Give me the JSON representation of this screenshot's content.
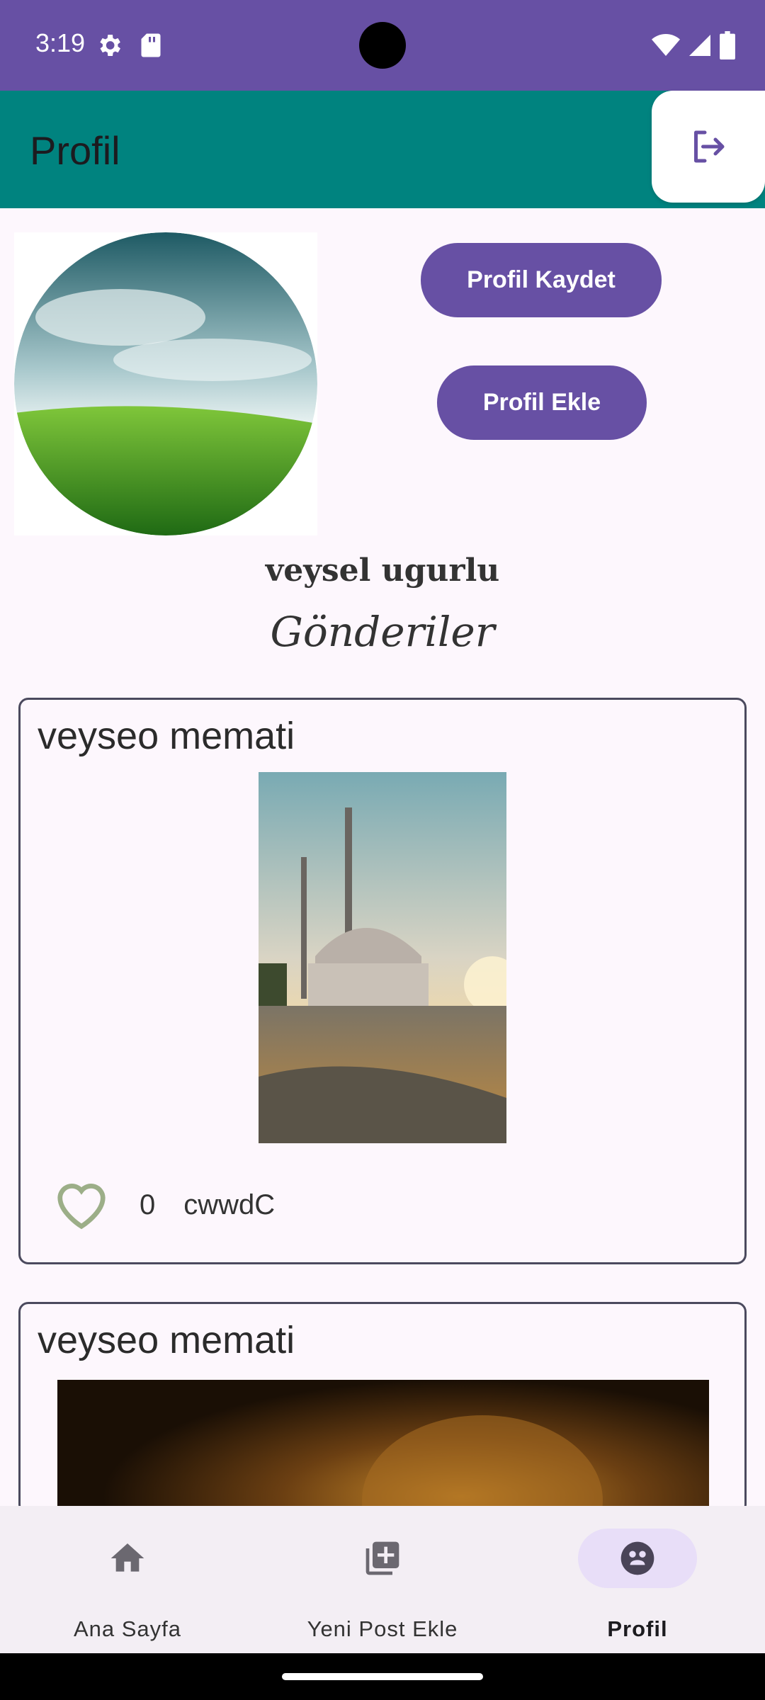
{
  "status_bar": {
    "time": "3:19",
    "icons": [
      "gear-icon",
      "sd-card-icon",
      "wifi-icon",
      "signal-icon",
      "battery-icon"
    ]
  },
  "app_bar": {
    "title": "Profil",
    "logout_icon": "logout-icon"
  },
  "profile": {
    "save_button": "Profil Kaydet",
    "add_button": "Profil Ekle",
    "username": "veysel ugurlu",
    "section_title": "Gönderiler"
  },
  "posts": [
    {
      "author": "veyseo memati",
      "likes": "0",
      "caption": "cwwdC"
    },
    {
      "author": "veyseo memati"
    }
  ],
  "bottom_nav": {
    "items": [
      {
        "label": "Ana Sayfa",
        "icon": "home-icon"
      },
      {
        "label": "Yeni Post Ekle",
        "icon": "add-post-icon"
      },
      {
        "label": "Profil",
        "icon": "profile-icon",
        "active": true
      }
    ]
  },
  "colors": {
    "primary": "#6750a4",
    "app_bar": "#00837f",
    "background": "#fdf7fd",
    "heart": "#9cae88"
  }
}
